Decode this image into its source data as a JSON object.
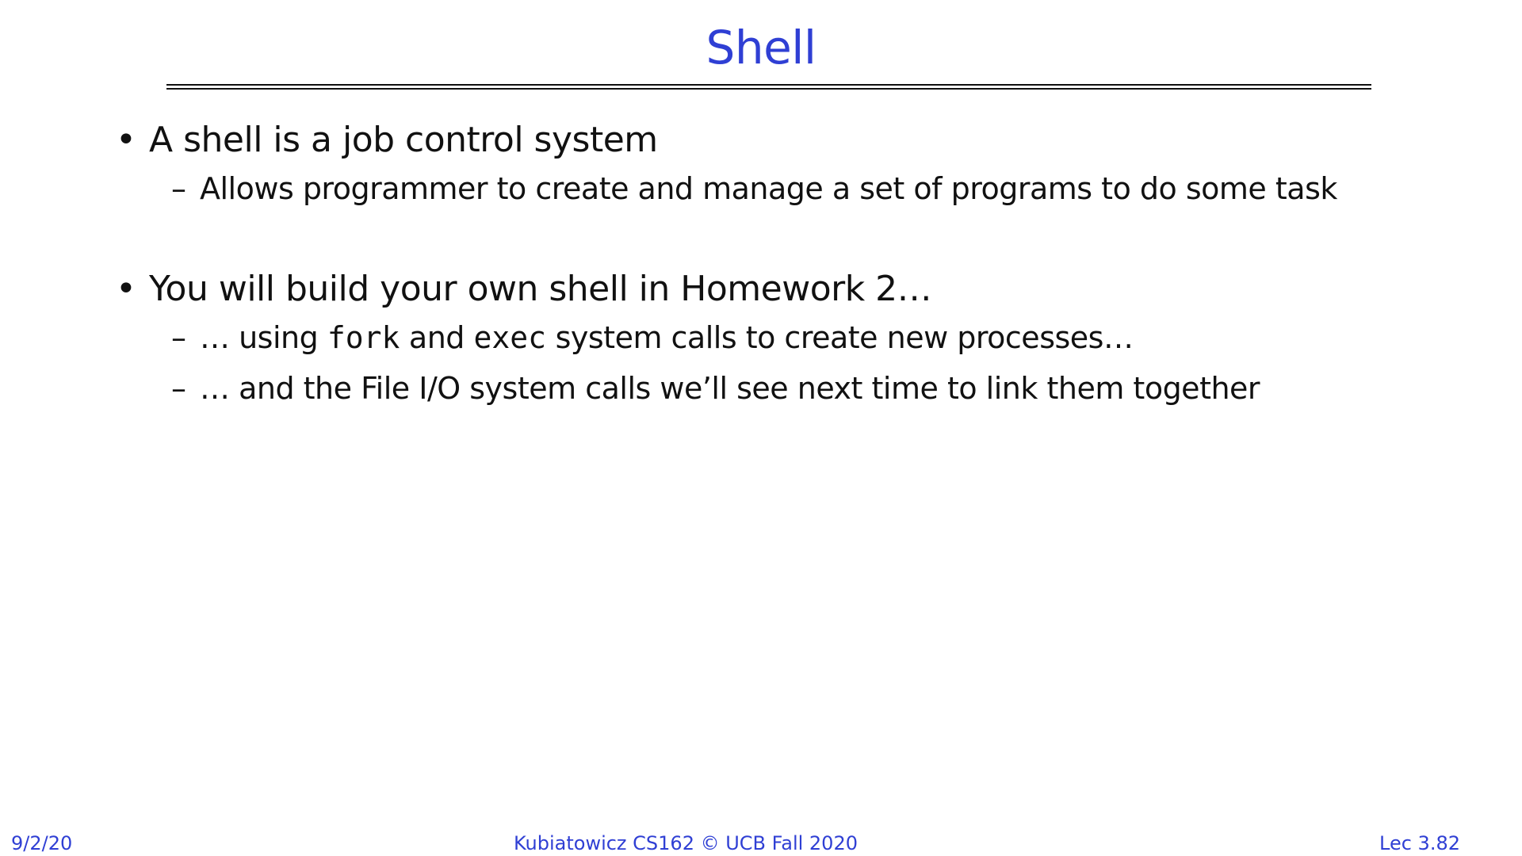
{
  "slide": {
    "title": "Shell",
    "bullets": [
      {
        "text": "A shell is a job control system",
        "sub": [
          {
            "text": "Allows programmer to create and manage a set of programs to do some task"
          }
        ]
      },
      {
        "text": "You will build your own shell in Homework 2…",
        "sub": [
          {
            "pre": "… using ",
            "code1": "fork",
            "mid": " and ",
            "code2": "exec",
            "post": " system calls to create new processes…"
          },
          {
            "text": "… and the File I/O system calls we’ll see next time to link them together"
          }
        ]
      }
    ],
    "bullet_glyph": "•",
    "dash_glyph": "–"
  },
  "footer": {
    "date": "9/2/20",
    "course": "Kubiatowicz CS162 © UCB Fall 2020",
    "lecture": "Lec 3.82"
  },
  "colors": {
    "accent": "#2f3fd4",
    "text": "#111111",
    "background": "#ffffff"
  }
}
